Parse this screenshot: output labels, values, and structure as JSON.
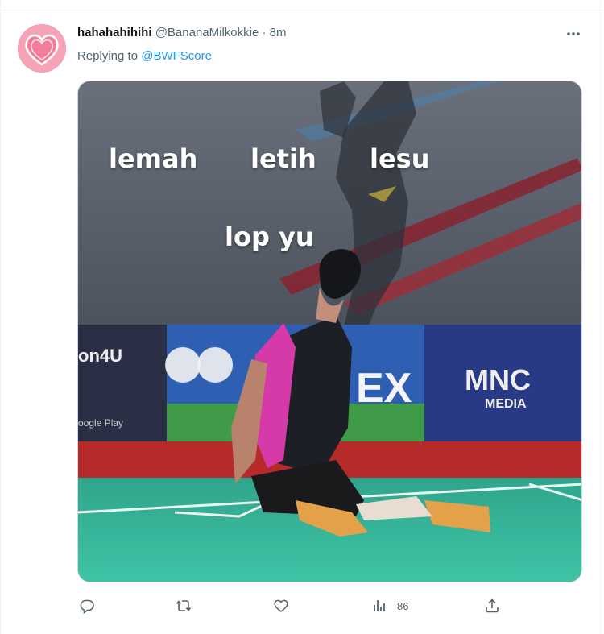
{
  "tweet": {
    "display_name": "hahahahihihi",
    "handle": "@BananaMilkokkie",
    "separator": "·",
    "time": "8m",
    "reply_prefix": "Replying to",
    "reply_to": "@BWFScore"
  },
  "media": {
    "captions": [
      "lemah",
      "letih",
      "lesu",
      "lop yu"
    ],
    "banner_texts": [
      "on4U",
      "EX",
      "MNC",
      "MEDIA",
      "oogle Play"
    ]
  },
  "actions": {
    "reply_icon": "comment-icon",
    "retweet_icon": "retweet-icon",
    "like_icon": "heart-icon",
    "views_icon": "analytics-icon",
    "views_count": "86",
    "share_icon": "share-icon"
  },
  "colors": {
    "link": "#1d9bf0",
    "secondary_text": "#536471",
    "primary_text": "#0f1419",
    "court_green": "#3bb39a",
    "jersey_pink": "#d63aa8"
  }
}
